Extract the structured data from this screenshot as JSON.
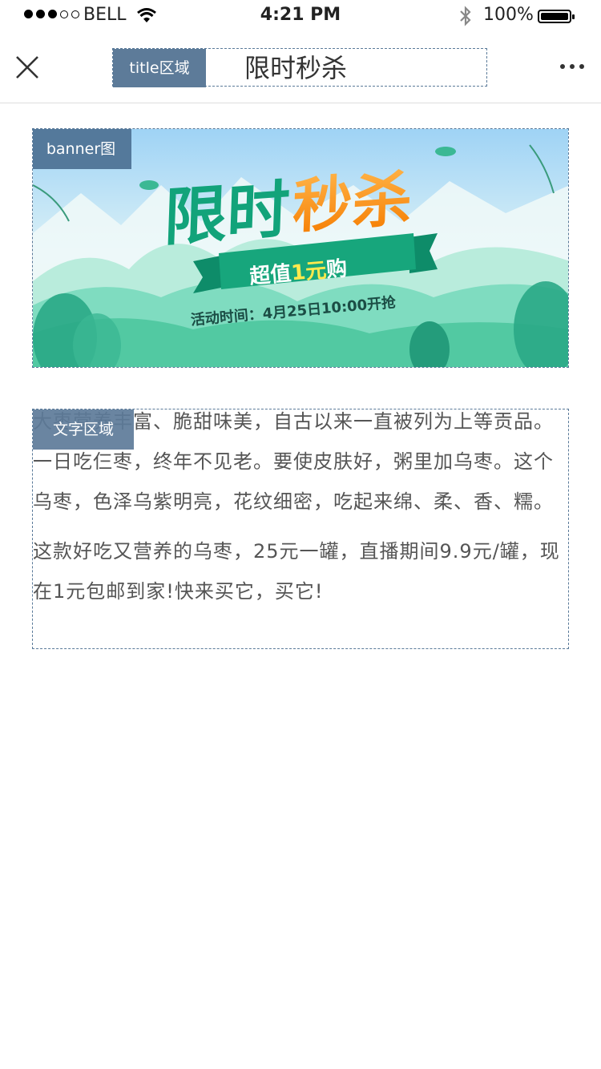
{
  "status_bar": {
    "carrier": "BELL",
    "time": "4:21 PM",
    "battery": "100%"
  },
  "nav": {
    "title_tag": "title区域",
    "title": "限时秒杀"
  },
  "banner": {
    "tag": "banner图",
    "headline_part1": "限时",
    "headline_part2": "秒杀",
    "ribbon_prefix": "超值",
    "ribbon_highlight": "1元",
    "ribbon_suffix": "购",
    "activity_time": "活动时间：4月25日10:00开抢"
  },
  "content": {
    "tag": "文字区域",
    "paragraph1": "大枣营养丰富、脆甜味美，自古以来一直被列为上等贡品。一日吃仨枣，终年不见老。要使皮肤好，粥里加乌枣。这个乌枣，色泽乌紫明亮，花纹细密，吃起来绵、柔、香、糯。",
    "paragraph2": "这款好吃又营养的乌枣，25元一罐，直播期间9.9元/罐，现在1元包邮到家!快来买它，买它!"
  },
  "colors": {
    "tag_bg": "#5d7b99",
    "headline_green": "#12a37a",
    "headline_orange": "#f7931e",
    "ribbon_green": "#17a67c"
  }
}
